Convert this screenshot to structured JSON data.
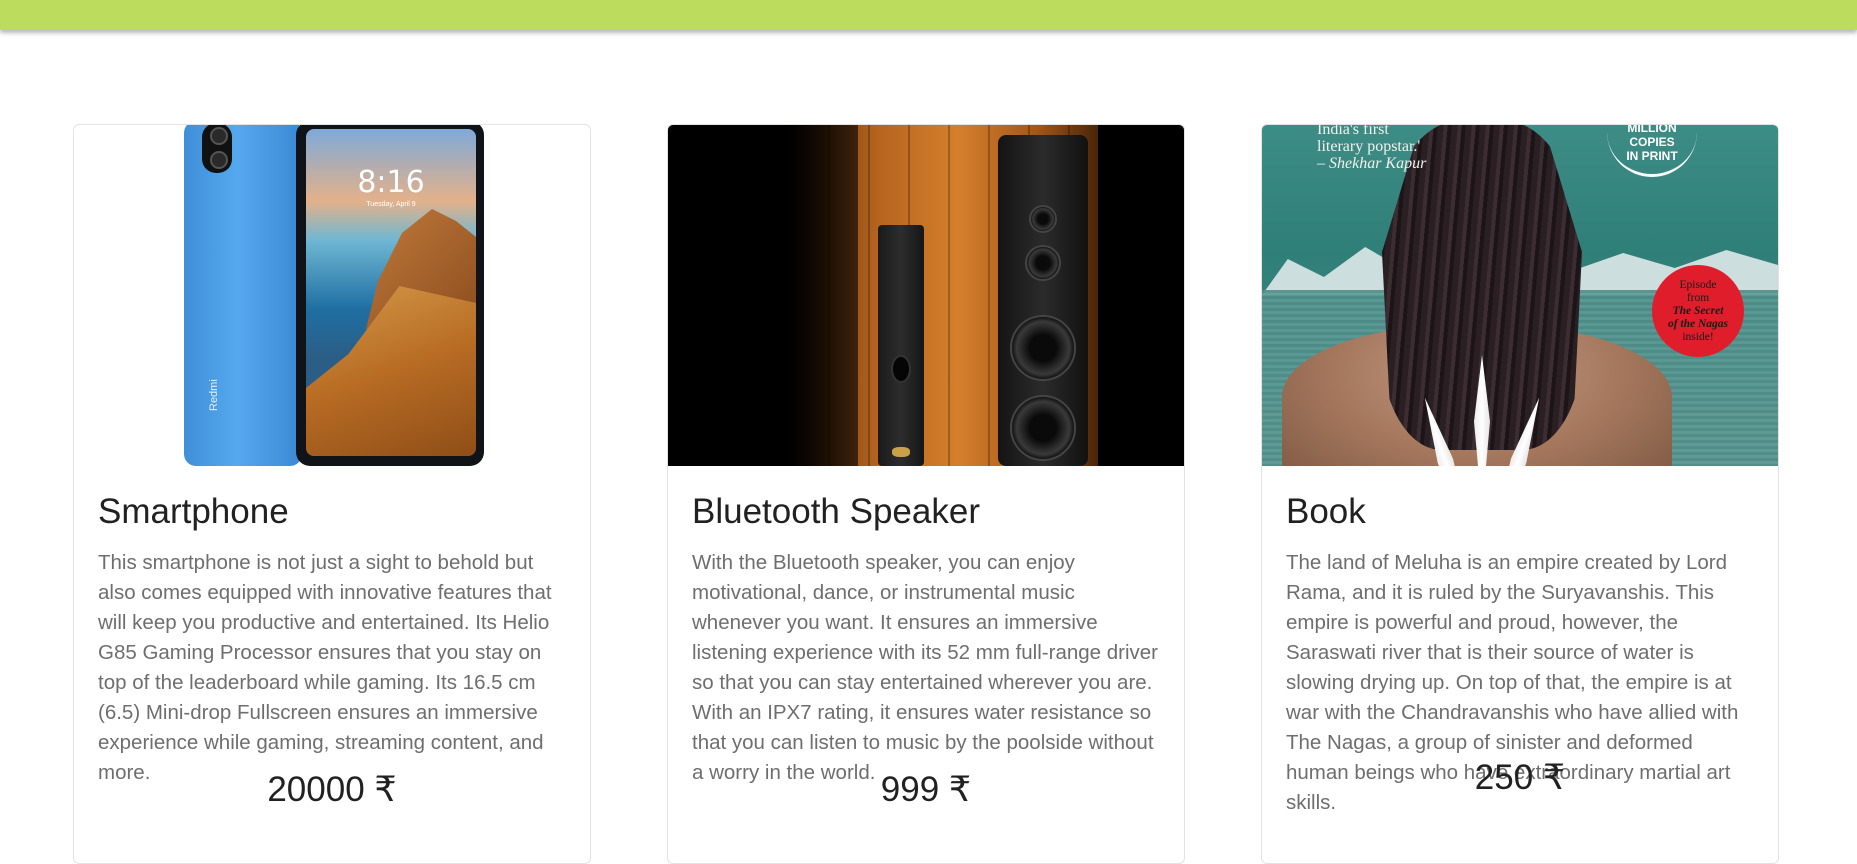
{
  "header": {
    "accent_color": "#bcdc5d"
  },
  "products": [
    {
      "title": "Smartphone",
      "description": "This smartphone is not just a sight to behold but also comes equipped with innovative features that will keep you productive and entertained. Its Helio G85 Gaming Processor ensures that you stay on top of the leaderboard while gaming. Its 16.5 cm (6.5) Mini-drop Fullscreen ensures an immersive experience while gaming, streaming content, and more.",
      "price": "20000 ₹",
      "image": {
        "phone_time": "8:16",
        "phone_date": "Tuesday, April 9",
        "brand": "Redmi"
      }
    },
    {
      "title": "Bluetooth Speaker",
      "description": "With the Bluetooth speaker, you can enjoy motivational, dance, or instrumental music whenever you want. It ensures an immersive listening experience with its 52 mm full-range driver so that you can stay entertained wherever you are. With an IPX7 rating, it ensures water resistance so that you can listen to music by the poolside without a worry in the world.",
      "price": "999 ₹"
    },
    {
      "title": "Book",
      "description": "The land of Meluha is an empire created by Lord Rama, and it is ruled by the Suryavanshis. This empire is powerful and proud, however, the Saraswati river that is their source of water is slowing drying up. On top of that, the empire is at war with the Chandravanshis who have allied with The Nagas, a group of sinister and deformed human beings who have extraordinary martial art skills.",
      "price": "250 ₹",
      "image": {
        "quote_line1": "India's first",
        "quote_line2": "literary popstar.'",
        "quote_author": "– Shekhar Kapur",
        "seal_line1": "MILLION",
        "seal_line2": "COPIES",
        "seal_line3": "IN PRINT",
        "badge_line1": "Episode",
        "badge_line2": "from",
        "badge_line3": "The Secret",
        "badge_line4": "of the Nagas",
        "badge_line5": "inside!"
      }
    }
  ]
}
